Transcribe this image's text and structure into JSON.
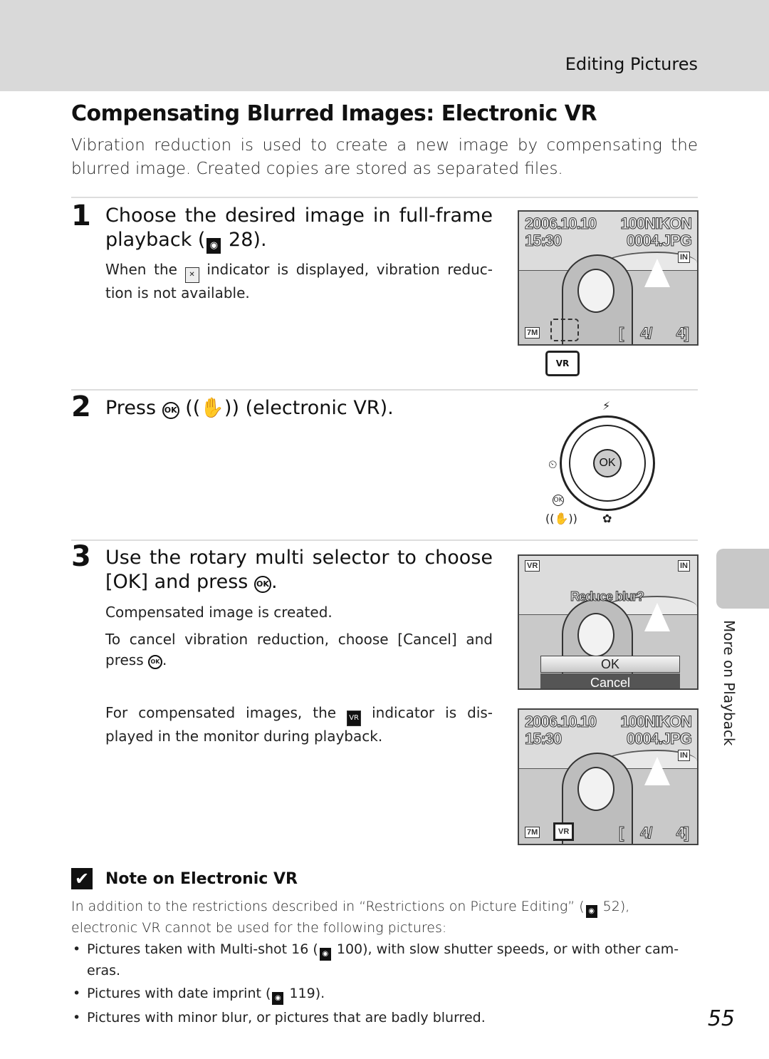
{
  "header": {
    "section": "Editing Pictures"
  },
  "title": "Compensating Blurred Images: Electronic VR",
  "intro": "Vibration reduction is used to create a new image by compensating the blurred image. Created copies are stored as separated files.",
  "steps": [
    {
      "number": "1",
      "heading_pre": "Choose the desired image in full-frame playback (",
      "heading_ref": "28",
      "heading_post": ").",
      "body_pre": "When the",
      "body_post": "indicator is displayed, vibration reduc- tion is not available."
    },
    {
      "number": "2",
      "heading_pre": "Press",
      "heading_post": "((✋)) (electronic VR)."
    },
    {
      "number": "3",
      "heading_pre": "Use the rotary multi selector to choose [OK] and press",
      "heading_post": ".",
      "body1": "Compensated image is created.",
      "body2_pre": "To cancel vibration reduction, choose [Cancel] and press",
      "body2_post": ".",
      "body3_pre": "For compensated images, the",
      "body3_post": "indicator is dis- played in the monitor during playback."
    }
  ],
  "screens": {
    "playback": {
      "date": "2006.10.10",
      "time": "15:30",
      "folder": "100NIKON",
      "file": "0004.JPG",
      "memory": "IN",
      "image_size": "7M",
      "frame_current": "4/",
      "frame_total": "4]",
      "frame_open": "[",
      "vr_off_icon": "VR"
    },
    "dialog": {
      "vr_icon": "VR",
      "memory": "IN",
      "prompt": "Reduce blur?",
      "ok": "OK",
      "cancel": "Cancel"
    },
    "result": {
      "date": "2006.10.10",
      "time": "15:30",
      "folder": "100NIKON",
      "file": "0004.JPG",
      "memory": "IN",
      "image_size": "7M",
      "vr_icon": "VR",
      "frame_current": "4/",
      "frame_total": "4]",
      "frame_open": "["
    }
  },
  "dial": {
    "center": "OK",
    "top": "⚡",
    "left": "⏲",
    "bottom": "✿",
    "ok_small": "OK",
    "vr_label": "((✋))"
  },
  "ok_glyph": "OK",
  "side_tab": "More on Playback",
  "note": {
    "check": "✔",
    "heading": "Note on Electronic VR",
    "body_pre": "In addition to the restrictions described in “Restrictions on Picture Editing” (",
    "body_ref": "52",
    "body_post": "), electronic VR cannot be used for the following pictures:",
    "items": [
      {
        "pre": "Pictures taken with Multi-shot 16 (",
        "ref": "100",
        "post": "), with slow shutter speeds, or with other cam- eras."
      },
      {
        "pre": "Pictures with date imprint (",
        "ref": "119",
        "post": ")."
      },
      {
        "pre": "Pictures with minor blur, or pictures that are badly blurred.",
        "ref": "",
        "post": ""
      }
    ]
  },
  "page_number": "55"
}
